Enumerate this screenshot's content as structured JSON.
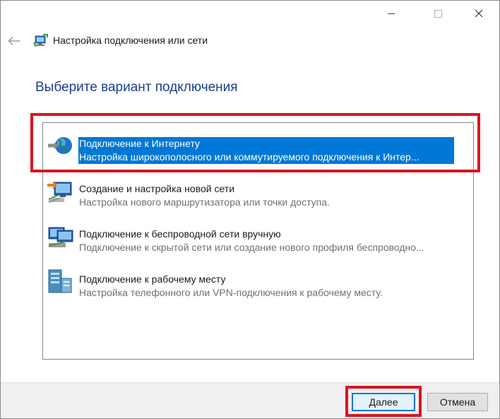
{
  "window": {
    "title": "Настройка подключения или сети",
    "heading": "Выберите вариант подключения"
  },
  "options": [
    {
      "title": "Подключение к Интернету",
      "description": "Настройка широкополосного или коммутируемого подключения к Интер...",
      "icon": "globe-internet-icon",
      "selected": true
    },
    {
      "title": "Создание и настройка новой сети",
      "description": "Настройка нового маршрутизатора или точки доступа.",
      "icon": "new-network-icon",
      "selected": false
    },
    {
      "title": "Подключение к беспроводной сети вручную",
      "description": "Подключение к скрытой сети или создание нового профиля беспроводно...",
      "icon": "wireless-network-icon",
      "selected": false
    },
    {
      "title": "Подключение к рабочему месту",
      "description": "Настройка телефонного или VPN-подключения к рабочему месту.",
      "icon": "workplace-vpn-icon",
      "selected": false
    }
  ],
  "buttons": {
    "next": "Далее",
    "cancel": "Отмена"
  },
  "colors": {
    "heading": "#1a3f8f",
    "selection": "#0078d7",
    "highlight_box": "#d9161e"
  }
}
